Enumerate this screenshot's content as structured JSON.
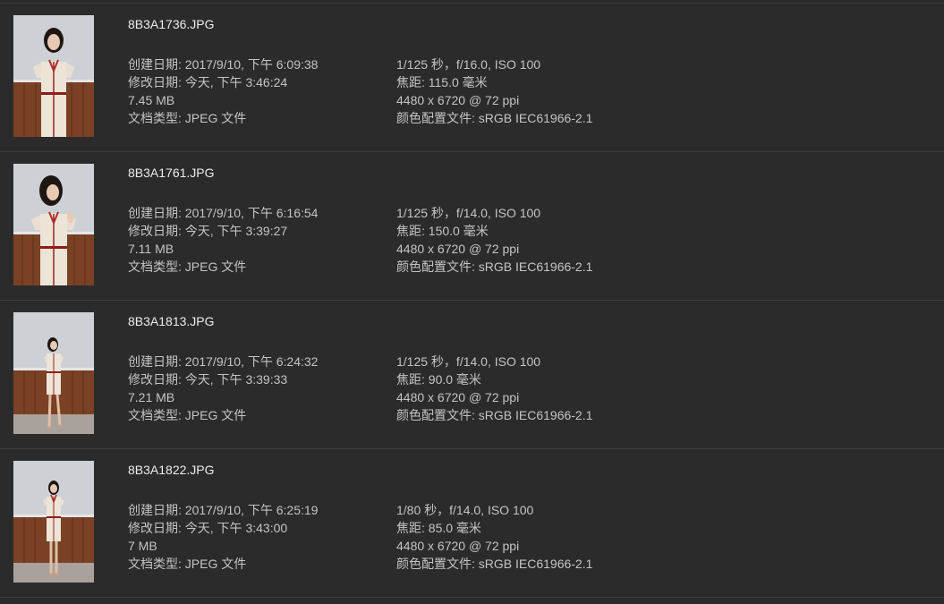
{
  "files": [
    {
      "name": "8B3A1736.JPG",
      "created": "创建日期: 2017/9/10, 下午 6:09:38",
      "modified": "修改日期: 今天, 下午 3:46:24",
      "size": "7.45 MB",
      "type": "文档类型: JPEG 文件",
      "exposure": "1/125 秒，f/16.0, ISO 100",
      "focal": "焦距: 115.0 毫米",
      "dimensions": "4480 x 6720 @ 72 ppi",
      "profile": "颜色配置文件: sRGB IEC61966-2.1",
      "thumb_icon": "portrait-photo-thumbnail"
    },
    {
      "name": "8B3A1761.JPG",
      "created": "创建日期: 2017/9/10, 下午 6:16:54",
      "modified": "修改日期: 今天, 下午 3:39:27",
      "size": "7.11 MB",
      "type": "文档类型: JPEG 文件",
      "exposure": "1/125 秒，f/14.0, ISO 100",
      "focal": "焦距: 150.0 毫米",
      "dimensions": "4480 x 6720 @ 72 ppi",
      "profile": "颜色配置文件: sRGB IEC61966-2.1",
      "thumb_icon": "portrait-photo-thumbnail"
    },
    {
      "name": "8B3A1813.JPG",
      "created": "创建日期: 2017/9/10, 下午 6:24:32",
      "modified": "修改日期: 今天, 下午 3:39:33",
      "size": "7.21 MB",
      "type": "文档类型: JPEG 文件",
      "exposure": "1/125 秒，f/14.0, ISO 100",
      "focal": "焦距: 90.0 毫米",
      "dimensions": "4480 x 6720 @ 72 ppi",
      "profile": "颜色配置文件: sRGB IEC61966-2.1",
      "thumb_icon": "full-body-photo-thumbnail"
    },
    {
      "name": "8B3A1822.JPG",
      "created": "创建日期: 2017/9/10, 下午 6:25:19",
      "modified": "修改日期: 今天, 下午 3:43:00",
      "size": "7 MB",
      "type": "文档类型: JPEG 文件",
      "exposure": "1/80 秒，f/14.0, ISO 100",
      "focal": "焦距: 85.0 毫米",
      "dimensions": "4480 x 6720 @ 72 ppi",
      "profile": "颜色配置文件: sRGB IEC61966-2.1",
      "thumb_icon": "full-body-photo-thumbnail"
    }
  ],
  "colors": {
    "background": "#2b2b2b",
    "separator": "#3e3e3e",
    "filename": "#ececec",
    "meta_text": "#c4c4c4"
  }
}
